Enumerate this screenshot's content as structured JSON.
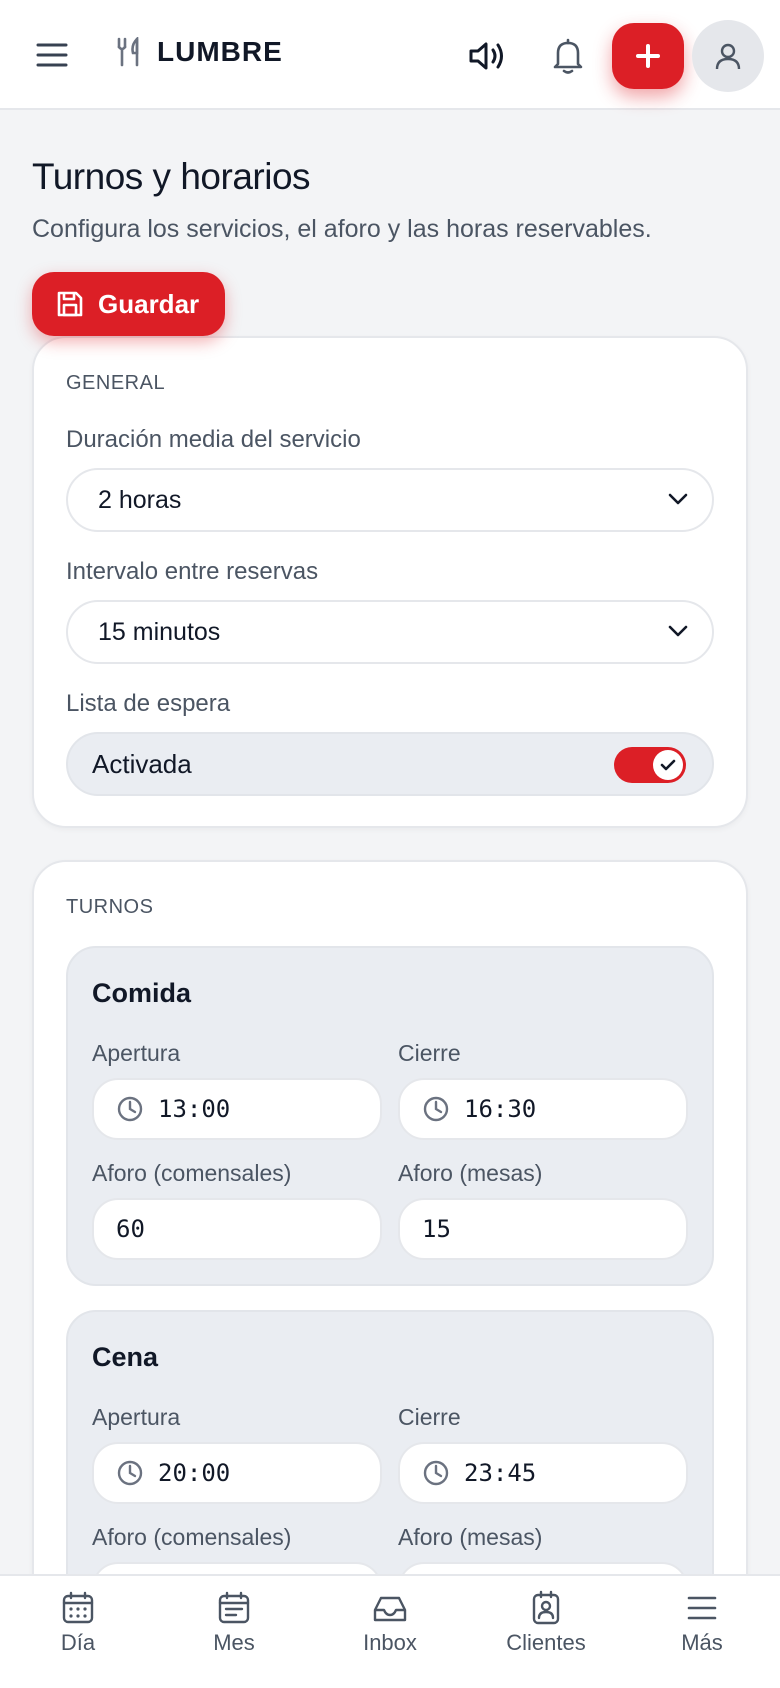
{
  "header": {
    "brand": "LUMBRE",
    "icons": {
      "menu": "menu-icon",
      "brand": "utensils-icon",
      "sound": "speaker-icon",
      "bell": "bell-icon",
      "add": "plus-icon",
      "avatar": "user-icon"
    },
    "accent_color": "#dc1f26"
  },
  "page": {
    "title": "Turnos y horarios",
    "subtitle": "Configura los servicios, el aforo y las horas reservables.",
    "save_label": "Guardar"
  },
  "general": {
    "section_label": "GENERAL",
    "duration": {
      "label": "Duración media del servicio",
      "value": "2 horas"
    },
    "interval": {
      "label": "Intervalo entre reservas",
      "value": "15 minutos"
    },
    "waitlist": {
      "label": "Lista de espera",
      "value": "Activada",
      "enabled": true
    }
  },
  "turnos": {
    "section_label": "TURNOS",
    "shifts": [
      {
        "name": "Comida",
        "open_label": "Apertura",
        "open": "13:00",
        "close_label": "Cierre",
        "close": "16:30",
        "diners_label": "Aforo (comensales)",
        "diners": "60",
        "tables_label": "Aforo (mesas)",
        "tables": "15"
      },
      {
        "name": "Cena",
        "open_label": "Apertura",
        "open": "20:00",
        "close_label": "Cierre",
        "close": "23:45",
        "diners_label": "Aforo (comensales)",
        "tables_label": "Aforo (mesas)"
      }
    ]
  },
  "nav": {
    "items": [
      {
        "label": "Día",
        "icon": "calendar-day-icon"
      },
      {
        "label": "Mes",
        "icon": "calendar-month-icon"
      },
      {
        "label": "Inbox",
        "icon": "inbox-icon"
      },
      {
        "label": "Clientes",
        "icon": "contact-card-icon"
      },
      {
        "label": "Más",
        "icon": "menu-icon"
      }
    ]
  }
}
